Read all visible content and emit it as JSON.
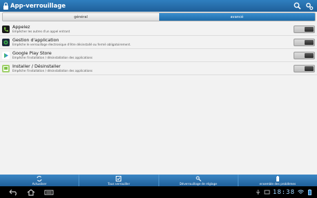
{
  "app": {
    "title": "App-verrouillage",
    "icon": "lock-icon",
    "actions": [
      "search-icon",
      "settings-icon"
    ]
  },
  "tabs": [
    {
      "label": "général",
      "active": false
    },
    {
      "label": "avancé",
      "active": true
    }
  ],
  "items": [
    {
      "icon": "phone-app-icon",
      "title": "Appelez",
      "subtitle": "Empêcher les autres d'un appel entrant",
      "enabled": false
    },
    {
      "icon": "app-manager-icon",
      "title": "Gestion d'application",
      "subtitle": "Empêche le verrouillage électronique d'être désinstallé ou fermé obligatoirement.",
      "enabled": false
    },
    {
      "icon": "play-store-icon",
      "title": "Google Play Store",
      "subtitle": "Empêche l'installation / désinstallation des applications",
      "enabled": false
    },
    {
      "icon": "installer-icon",
      "title": "Installer / Désinstaller",
      "subtitle": "Empêche l'installation / désinstallation des applications",
      "enabled": false
    }
  ],
  "toolbar": [
    {
      "icon": "refresh-icon",
      "label": "Actualiser"
    },
    {
      "icon": "checkbox-icon",
      "label": "Tous verrouiller"
    },
    {
      "icon": "settings-icon",
      "label": "Déverrouillage de réglage"
    },
    {
      "icon": "battery-icon",
      "label": "ensemble des problèmes"
    }
  ],
  "system": {
    "nav": [
      "back-icon",
      "home-icon",
      "recent-apps-icon"
    ],
    "status_icons": [
      "usb-icon",
      "screenshot-icon",
      "wifi-icon",
      "battery-icon"
    ],
    "time": "18:38"
  },
  "colors": {
    "accent": "#1f5f99",
    "active_tab": "#2a7bbd",
    "clock": "#9fd7ff"
  }
}
